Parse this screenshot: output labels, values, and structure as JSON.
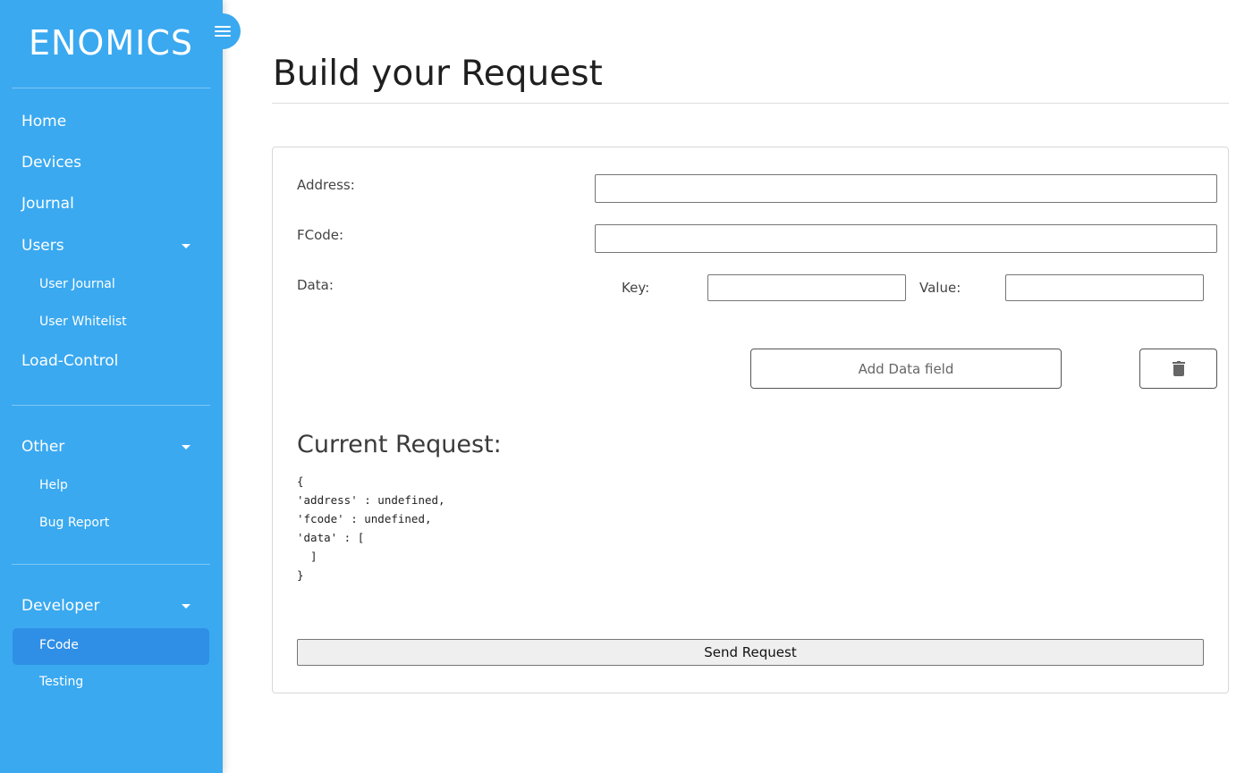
{
  "sidebar": {
    "logo": "ENOMICS",
    "items": {
      "home": "Home",
      "devices": "Devices",
      "journal": "Journal",
      "users": "Users",
      "user_journal": "User Journal",
      "user_whitelist": "User Whitelist",
      "load_control": "Load-Control",
      "other": "Other",
      "help": "Help",
      "bug_report": "Bug Report",
      "developer": "Developer",
      "fcode": "FCode",
      "testing": "Testing"
    },
    "active_item": "FCode",
    "colors": {
      "background": "#3aa9f0",
      "active": "#2f8fe6"
    }
  },
  "main": {
    "title": "Build your Request",
    "form": {
      "address_label": "Address:",
      "address_value": "",
      "fcode_label": "FCode:",
      "fcode_value": "",
      "data_label": "Data:",
      "key_label": "Key:",
      "key_value": "",
      "value_label": "Value:",
      "value_value": "",
      "add_button": "Add Data field",
      "delete_icon": "trash-icon"
    },
    "current_request": {
      "heading": "Current Request:",
      "json_text": "{\n'address' : undefined,\n'fcode' : undefined,\n'data' : [\n  ]\n}"
    },
    "send_button": "Send Request"
  }
}
